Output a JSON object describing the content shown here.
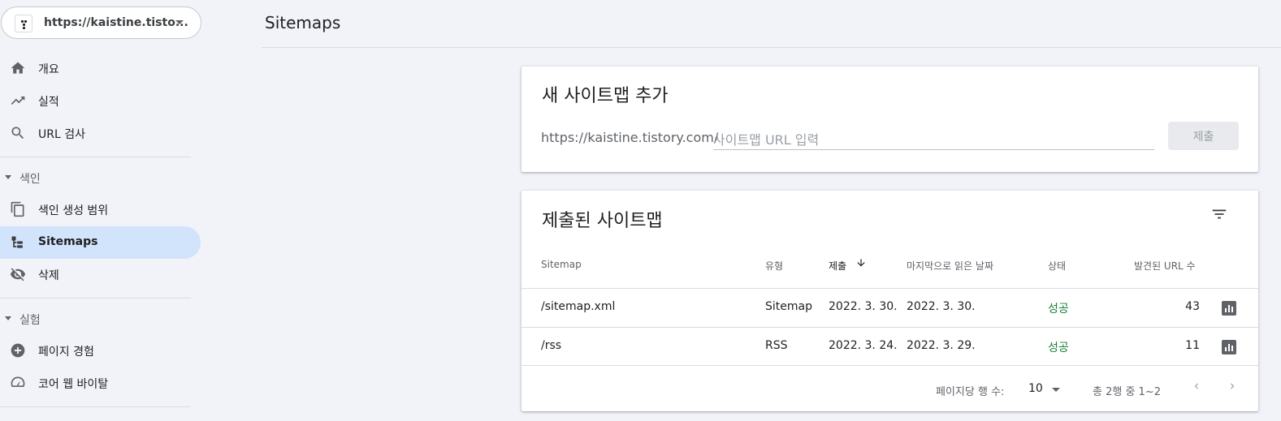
{
  "property": {
    "url": "https://kaistine.tisto..."
  },
  "sidebar": {
    "items": [
      {
        "label": "개요",
        "icon": "home-icon"
      },
      {
        "label": "실적",
        "icon": "trending-up-icon"
      },
      {
        "label": "URL 검사",
        "icon": "search-icon"
      }
    ],
    "section_index": {
      "title": "색인",
      "items": [
        {
          "label": "색인 생성 범위",
          "icon": "copy-pages-icon"
        },
        {
          "label": "Sitemaps",
          "icon": "sitemap-icon",
          "active": true
        },
        {
          "label": "삭제",
          "icon": "visibility-off-icon"
        }
      ]
    },
    "section_experience": {
      "title": "실험",
      "items": [
        {
          "label": "페이지 경험",
          "icon": "plus-circle-icon"
        },
        {
          "label": "코어 웹 바이탈",
          "icon": "speed-gauge-icon"
        }
      ]
    }
  },
  "header": {
    "title": "Sitemaps"
  },
  "add_sitemap": {
    "title": "새 사이트맵 추가",
    "prefix": "https://kaistine.tistory.com/",
    "placeholder": "사이트맵 URL 입력",
    "submit_label": "제출"
  },
  "submitted": {
    "title": "제출된 사이트맵",
    "columns": [
      "Sitemap",
      "유형",
      "제출",
      "마지막으로 읽은 날짜",
      "상태",
      "발견된 URL 수"
    ],
    "rows": [
      {
        "sitemap": "/sitemap.xml",
        "type": "Sitemap",
        "submitted": "2022. 3. 30.",
        "last_read": "2022. 3. 30.",
        "status": "성공",
        "urls": "43"
      },
      {
        "sitemap": "/rss",
        "type": "RSS",
        "submitted": "2022. 3. 24.",
        "last_read": "2022. 3. 29.",
        "status": "성공",
        "urls": "11"
      }
    ],
    "pager": {
      "rows_per_page_label": "페이지당 행 수:",
      "rows_per_page": "10",
      "range": "총 2행 중 1~2"
    }
  },
  "colors": {
    "accent": "#1a73e8",
    "active_nav": "#d2e3fc",
    "success": "#188038"
  }
}
